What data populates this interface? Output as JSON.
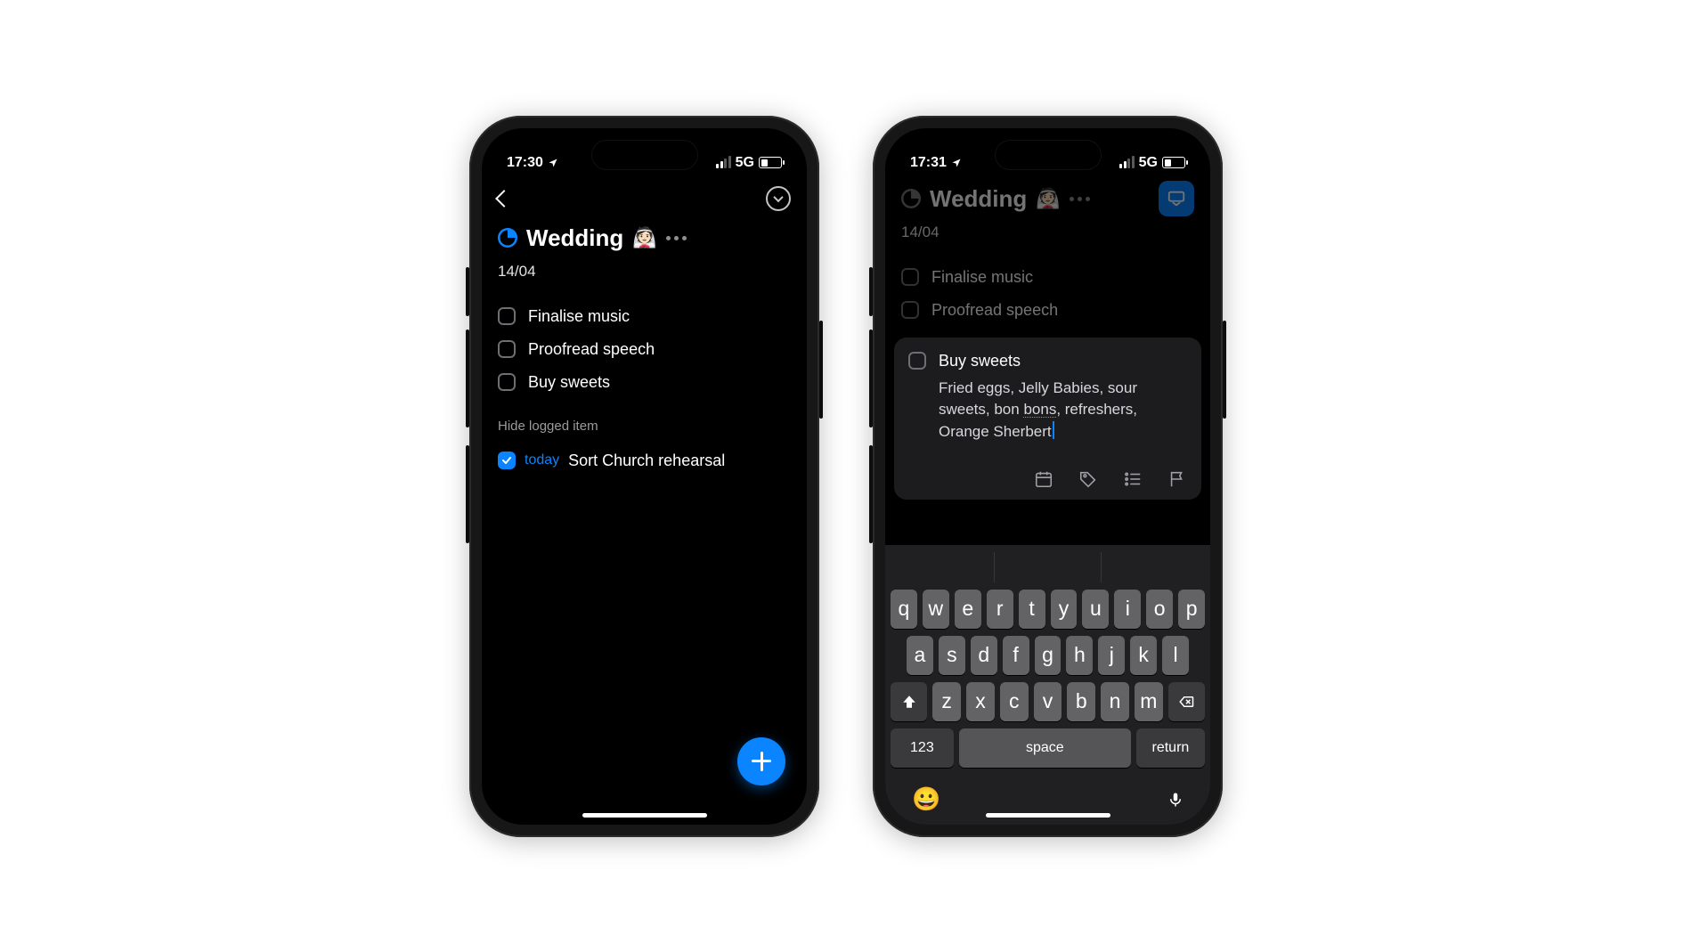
{
  "phone1": {
    "status": {
      "time": "17:30",
      "net": "5G"
    },
    "title": "Wedding",
    "title_emoji": "👰🏻",
    "date": "14/04",
    "tasks": [
      "Finalise music",
      "Proofread speech",
      "Buy sweets"
    ],
    "section_label": "Hide logged item",
    "logged_tag": "today",
    "logged_task": "Sort Church rehearsal"
  },
  "phone2": {
    "status": {
      "time": "17:31",
      "net": "5G"
    },
    "title": "Wedding",
    "title_emoji": "👰🏻",
    "date": "14/04",
    "dim_tasks": [
      "Finalise music",
      "Proofread speech"
    ],
    "edit_task": "Buy sweets",
    "edit_notes_pre": "Fried eggs, Jelly Babies, sour sweets, bon ",
    "edit_notes_ul": "bons",
    "edit_notes_post": ", refreshers, Orange Sherbert",
    "kb": {
      "row1": [
        "q",
        "w",
        "e",
        "r",
        "t",
        "y",
        "u",
        "i",
        "o",
        "p"
      ],
      "row2": [
        "a",
        "s",
        "d",
        "f",
        "g",
        "h",
        "j",
        "k",
        "l"
      ],
      "row3": [
        "z",
        "x",
        "c",
        "v",
        "b",
        "n",
        "m"
      ],
      "num": "123",
      "space": "space",
      "ret": "return",
      "emoji": "😀"
    }
  }
}
